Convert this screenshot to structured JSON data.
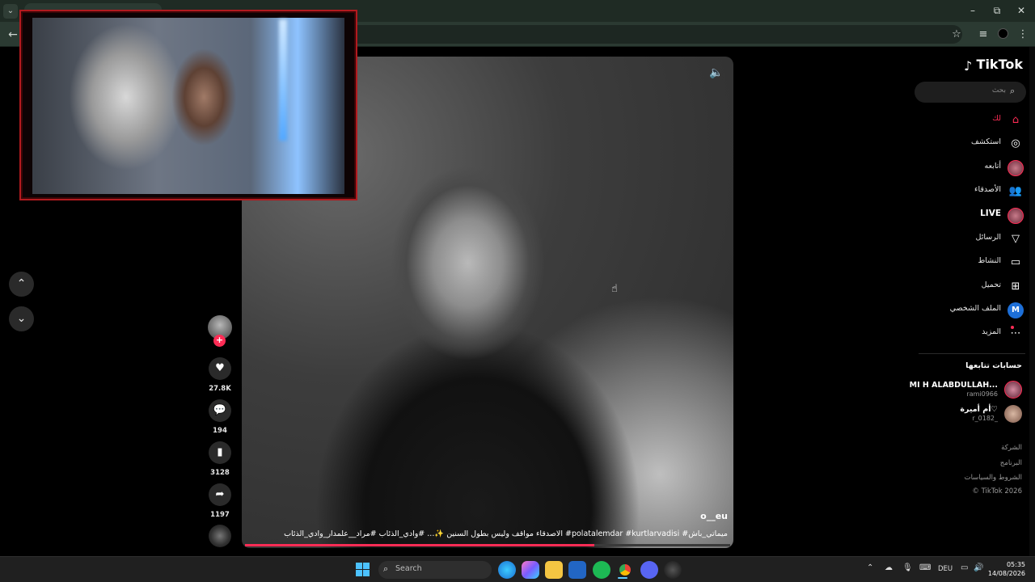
{
  "browser": {
    "menu_icon": "chevron-down-icon",
    "back_icon": "arrow-left-icon",
    "controls": {
      "minimize": "–",
      "restore": "⧉",
      "close": "✕"
    }
  },
  "video": {
    "author": "o__eu",
    "caption": "الاصدقاء مواقف وليس بطول السنين ✨... #وادي_الذئاب #مراد__علمدار_وادي_الذئاب #polatalemdar #kurtlarvadisi #ميماتي_باش",
    "progress": 0.72
  },
  "actions": {
    "likes": "27.8K",
    "comments": "194",
    "saves": "3128",
    "shares": "1197"
  },
  "sidebar": {
    "brand": "TikTok",
    "search_placeholder": "بحث",
    "nav": [
      {
        "label": "لك",
        "icon": "home-icon"
      },
      {
        "label": "استكشف",
        "icon": "compass-icon"
      },
      {
        "label": "أتابعه",
        "icon": "avatar-icon"
      },
      {
        "label": "الأصدقاء",
        "icon": "friends-icon"
      },
      {
        "label": "LIVE",
        "icon": "live-avatar-icon"
      },
      {
        "label": "الرسائل",
        "icon": "send-icon"
      },
      {
        "label": "النشاط",
        "icon": "activity-icon"
      },
      {
        "label": "تحميل",
        "icon": "upload-icon"
      },
      {
        "label": "الملف الشخصي",
        "icon": "profile-icon",
        "badge": "M"
      },
      {
        "label": "المزيد",
        "icon": "more-icon"
      }
    ],
    "following_header": "حسابات تتابعها",
    "following": [
      {
        "name": "MI H ALABDULLAH...",
        "user": "rami0966"
      },
      {
        "name": "أم أميرة♡",
        "user": "r_0182_"
      }
    ],
    "footer": [
      "الشركة",
      "البرنامج",
      "الشروط والسياسات",
      "© TikTok 2026"
    ]
  },
  "taskbar": {
    "search_label": "Search",
    "language": "DEU",
    "time": "05:35",
    "date": "14/08/2026"
  },
  "colors": {
    "accent": "#fe2c55",
    "chrome_bg": "#1f2b24",
    "taskbar_bg": "#202020"
  }
}
